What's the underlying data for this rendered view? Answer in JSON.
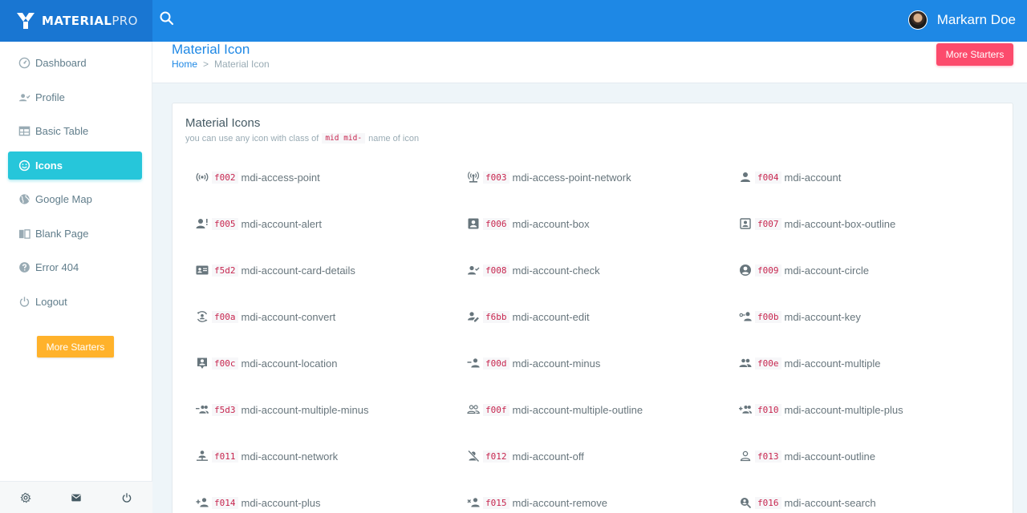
{
  "brand": {
    "bold": "MATERIAL",
    "light": "PRO"
  },
  "user": {
    "name": "Markarn Doe"
  },
  "sidebar": {
    "items": [
      {
        "label": "Dashboard",
        "icon": "gauge-icon"
      },
      {
        "label": "Profile",
        "icon": "account-check-icon"
      },
      {
        "label": "Basic Table",
        "icon": "table-icon"
      },
      {
        "label": "Icons",
        "icon": "emoticon-icon",
        "active": true
      },
      {
        "label": "Google Map",
        "icon": "earth-icon"
      },
      {
        "label": "Blank Page",
        "icon": "book-open-icon"
      },
      {
        "label": "Error 404",
        "icon": "help-circle-icon"
      },
      {
        "label": "Logout",
        "icon": "power-icon"
      }
    ],
    "button": "More Starters"
  },
  "page": {
    "title": "Material Icon",
    "breadcrumb": {
      "home": "Home",
      "separator": ">",
      "current": "Material Icon"
    },
    "button": "More Starters"
  },
  "card": {
    "title": "Material Icons",
    "subtitle_before": "you can use any icon with class of",
    "subtitle_code": "mid mid-",
    "subtitle_after": "name of icon"
  },
  "icons": [
    {
      "code": "f002",
      "name": "mdi-access-point"
    },
    {
      "code": "f003",
      "name": "mdi-access-point-network"
    },
    {
      "code": "f004",
      "name": "mdi-account"
    },
    {
      "code": "f005",
      "name": "mdi-account-alert"
    },
    {
      "code": "f006",
      "name": "mdi-account-box"
    },
    {
      "code": "f007",
      "name": "mdi-account-box-outline"
    },
    {
      "code": "f5d2",
      "name": "mdi-account-card-details"
    },
    {
      "code": "f008",
      "name": "mdi-account-check"
    },
    {
      "code": "f009",
      "name": "mdi-account-circle"
    },
    {
      "code": "f00a",
      "name": "mdi-account-convert"
    },
    {
      "code": "f6bb",
      "name": "mdi-account-edit"
    },
    {
      "code": "f00b",
      "name": "mdi-account-key"
    },
    {
      "code": "f00c",
      "name": "mdi-account-location"
    },
    {
      "code": "f00d",
      "name": "mdi-account-minus"
    },
    {
      "code": "f00e",
      "name": "mdi-account-multiple"
    },
    {
      "code": "f5d3",
      "name": "mdi-account-multiple-minus"
    },
    {
      "code": "f00f",
      "name": "mdi-account-multiple-outline"
    },
    {
      "code": "f010",
      "name": "mdi-account-multiple-plus"
    },
    {
      "code": "f011",
      "name": "mdi-account-network"
    },
    {
      "code": "f012",
      "name": "mdi-account-off"
    },
    {
      "code": "f013",
      "name": "mdi-account-outline"
    },
    {
      "code": "f014",
      "name": "mdi-account-plus"
    },
    {
      "code": "f015",
      "name": "mdi-account-remove"
    },
    {
      "code": "f016",
      "name": "mdi-account-search"
    }
  ],
  "colors": {
    "topbar": "#1e88e5",
    "brand_bg": "#1976d2",
    "active_nav": "#26c6da",
    "sidebar_button": "#ffb22b",
    "header_button": "#fc4b6c"
  }
}
